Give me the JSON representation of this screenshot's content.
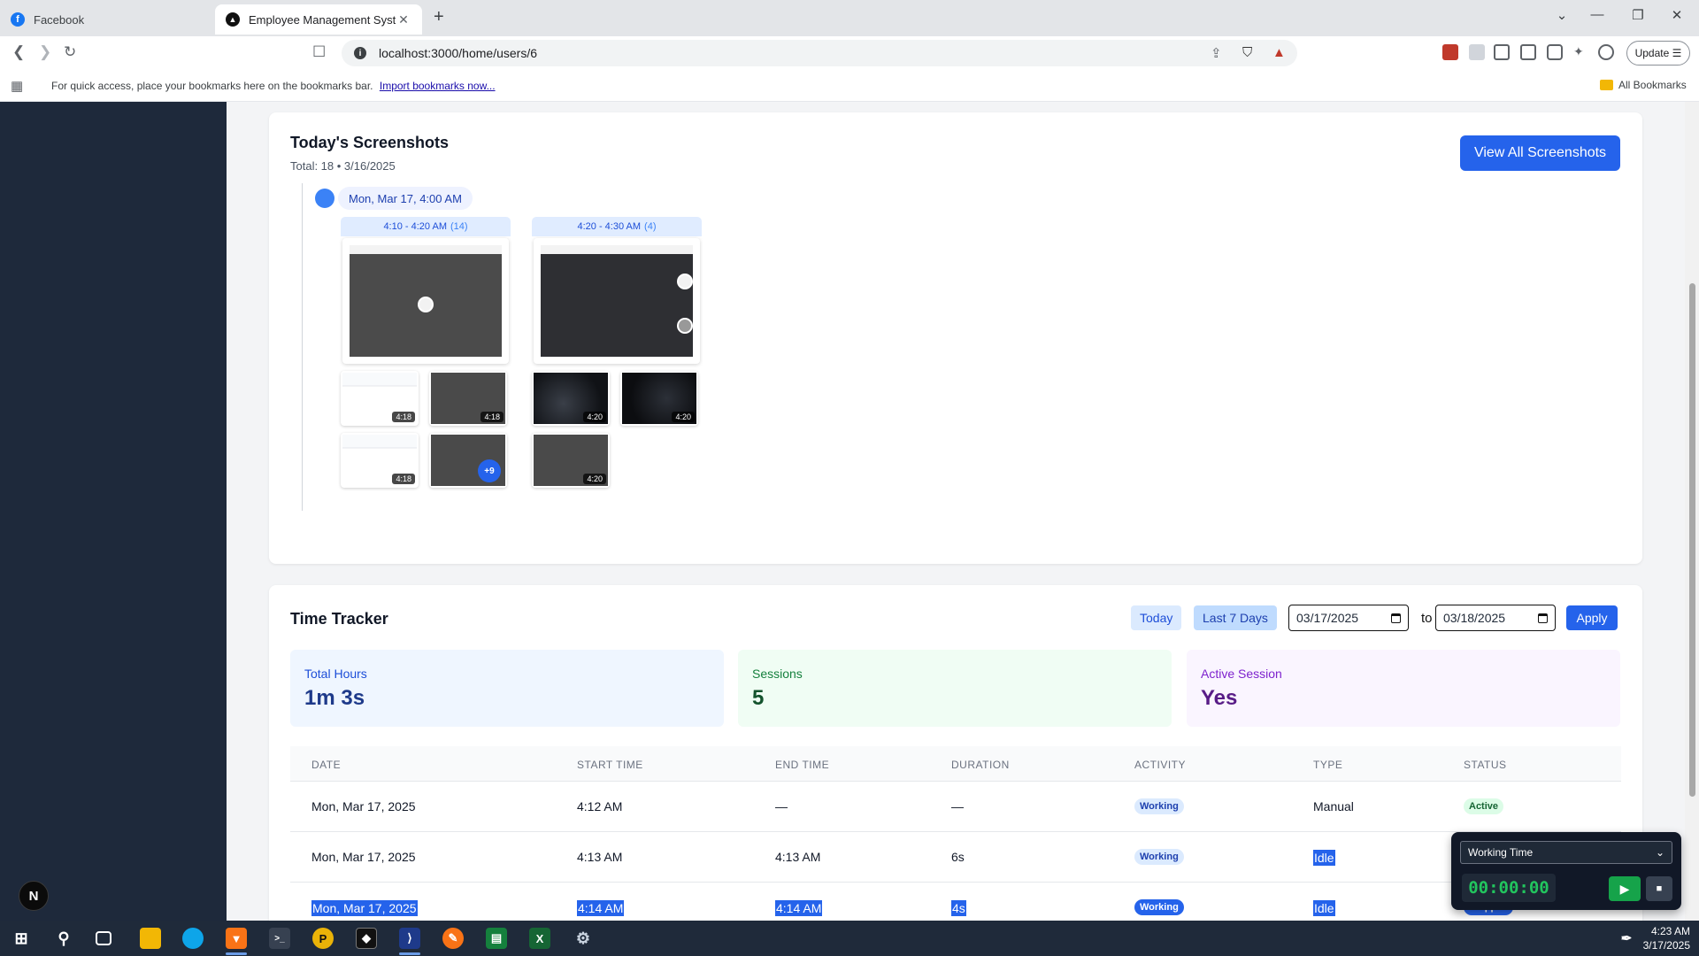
{
  "browser": {
    "tabs": [
      {
        "title": "Facebook",
        "active": false
      },
      {
        "title": "Employee Management System",
        "active": true
      }
    ],
    "url": "localhost:3000/home/users/6",
    "update_label": "Update",
    "bookmarks_bar": {
      "text": "For quick access, place your bookmarks here on the bookmarks bar.",
      "link": "Import bookmarks now...",
      "all_bookmarks": "All Bookmarks"
    }
  },
  "sidebar": {
    "badge": "N"
  },
  "screenshots": {
    "title": "Today's Screenshots",
    "subtitle": "Total: 18 • 3/16/2025",
    "view_all": "View All Screenshots",
    "hour_label": "Mon, Mar 17, 4:00 AM",
    "groups": [
      {
        "range": "4:10 - 4:20 AM",
        "count": "(14)",
        "thumb_times": [
          "4:18",
          "4:18",
          "4:18"
        ],
        "more": "+9"
      },
      {
        "range": "4:20 - 4:30 AM",
        "count": "(4)",
        "thumb_times": [
          "4:20",
          "4:20",
          "4:20"
        ]
      }
    ]
  },
  "time_tracker": {
    "title": "Time Tracker",
    "btn_today": "Today",
    "btn_7days": "Last 7 Days",
    "date_from": "03/17/2025",
    "to_label": "to",
    "date_to": "03/18/2025",
    "apply": "Apply",
    "stats": {
      "total_hours_label": "Total Hours",
      "total_hours_value": "1m 3s",
      "sessions_label": "Sessions",
      "sessions_value": "5",
      "active_label": "Active Session",
      "active_value": "Yes"
    },
    "columns": [
      "DATE",
      "START TIME",
      "END TIME",
      "DURATION",
      "ACTIVITY",
      "TYPE",
      "STATUS"
    ],
    "rows": [
      {
        "date": "Mon, Mar 17, 2025",
        "start": "4:12 AM",
        "end": "—",
        "duration": "—",
        "activity": "Working",
        "type": "Manual",
        "status": "Active"
      },
      {
        "date": "Mon, Mar 17, 2025",
        "start": "4:13 AM",
        "end": "4:13 AM",
        "duration": "6s",
        "activity": "Working",
        "type": "Idle",
        "status": ""
      },
      {
        "date": "Mon, Mar 17, 2025",
        "start": "4:14 AM",
        "end": "4:14 AM",
        "duration": "4s",
        "activity": "Working",
        "type": "Idle",
        "status": "Stopped"
      }
    ]
  },
  "widget": {
    "mode": "Working Time",
    "timer": "00:00:00"
  },
  "taskbar": {
    "time": "4:23 AM",
    "date": "3/17/2025"
  },
  "colors": {
    "accent": "#2563eb",
    "sidebar": "#1e293b"
  }
}
